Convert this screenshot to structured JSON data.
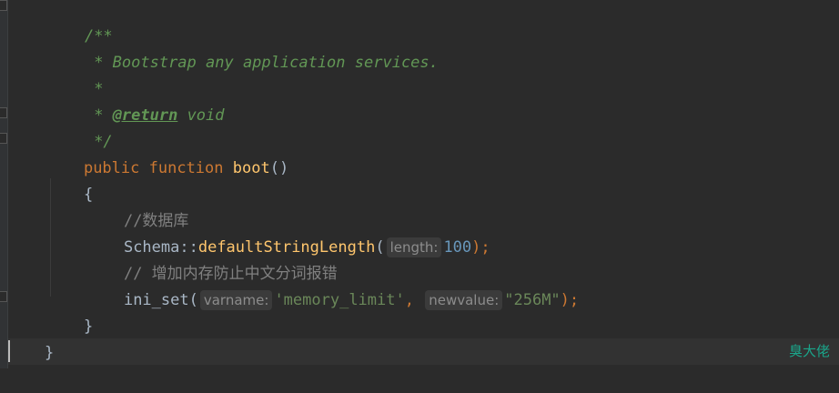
{
  "code": {
    "doc_open": "/**",
    "doc_line1": " * Bootstrap any application services.",
    "doc_star": " *",
    "doc_return_prefix": " * ",
    "doc_return_tag": "@return",
    "doc_return_type": " void",
    "doc_close": " */",
    "sig_public": "public",
    "sig_function": "function",
    "sig_name": "boot",
    "sig_parens": "()",
    "brace_open": "{",
    "comment1": "//数据库",
    "schema_class": "Schema::",
    "schema_method": "defaultStringLength",
    "paren_open": "(",
    "hint_length": "length:",
    "arg_length": "100",
    "paren_close_semi": ");",
    "comment2": "// 增加内存防止中文分词报错",
    "ini_fn": "ini_set",
    "hint_varname": "varname:",
    "arg_varname": "'memory_limit'",
    "comma": ", ",
    "hint_newvalue": "newvalue:",
    "arg_newvalue": "\"256M\"",
    "brace_close_inner": "}",
    "brace_close_outer": "}"
  },
  "watermark": "臭大佬",
  "colors": {
    "background": "#2b2b2b",
    "keyword": "#cc7832",
    "function": "#ffc66d",
    "number": "#6897bb",
    "string": "#6a8759",
    "doc_comment": "#629755",
    "comment": "#808080",
    "watermark": "#1aa58a"
  }
}
